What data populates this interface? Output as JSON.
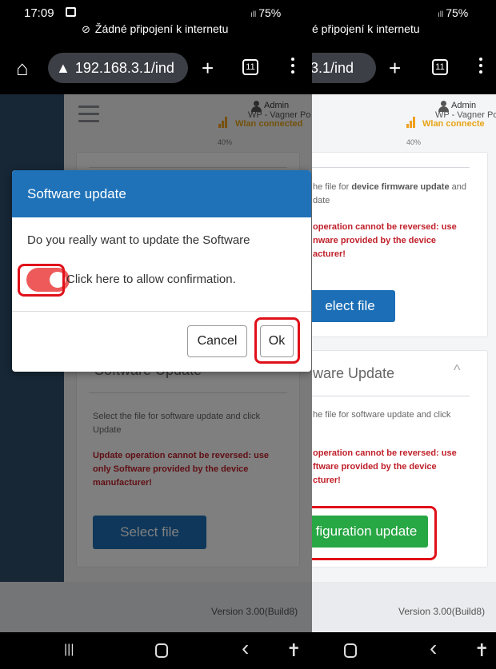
{
  "status": {
    "time": "17:09",
    "battery": "75%",
    "signal_glyph": "ıll",
    "no_internet_left": "Žádné připojení k internetu",
    "no_internet_right": "é připojení k internetu"
  },
  "toolbar": {
    "url_left": "192.168.3.1/ind",
    "url_right": "3.1/ind",
    "tab_count": "11"
  },
  "header": {
    "user": "Admin",
    "device": "WP - Vagner Po",
    "device_right": "WP - Vagner Poc",
    "wlan_left": "Wlan connected",
    "wlan_right": "Wlan connecte",
    "signal_percent": "40%"
  },
  "firmware_card": {
    "text_line1": "he file for",
    "text_bold": "device firmware update",
    "text_and": "and",
    "text_line2": "date",
    "warn_line1": "operation cannot be reversed: use",
    "warn_line2": "nware provided by the device",
    "warn_line3": "acturer!",
    "select_label": "elect file"
  },
  "software_card": {
    "title_left": "Software Update",
    "title_right": "ware Update",
    "text_left_1": "Select the file for software update and click",
    "text_left_2": "Update",
    "text_right_1": "he file for software update and click",
    "warn_left_1": "Update operation cannot be reversed: use",
    "warn_left_2": "only Software provided by the device",
    "warn_left_3": "manufacturer!",
    "warn_right_1": "operation cannot be reversed: use",
    "warn_right_2": "ftware provided by the device",
    "warn_right_3": "cturer!",
    "select_label": "Select file",
    "config_label": "figuration update"
  },
  "footer": {
    "version": "Version 3.00(Build8)"
  },
  "modal": {
    "title": "Software update",
    "question": "Do you really want to update the Software",
    "toggle_label": "Click here to allow confirmation.",
    "toggle_on": true,
    "cancel_label": "Cancel",
    "ok_label": "Ok"
  },
  "nav": {
    "recents_glyph": "|||",
    "back_glyph": "‹",
    "accessibility_glyph": "✝"
  },
  "colors": {
    "header_blue": "#1f72b8",
    "toggle_red": "#ee5a5a",
    "highlight_red": "#e0101a",
    "sidebar": "#2e4f6c",
    "green_button": "#28a745",
    "warning_text": "#c0202a"
  }
}
